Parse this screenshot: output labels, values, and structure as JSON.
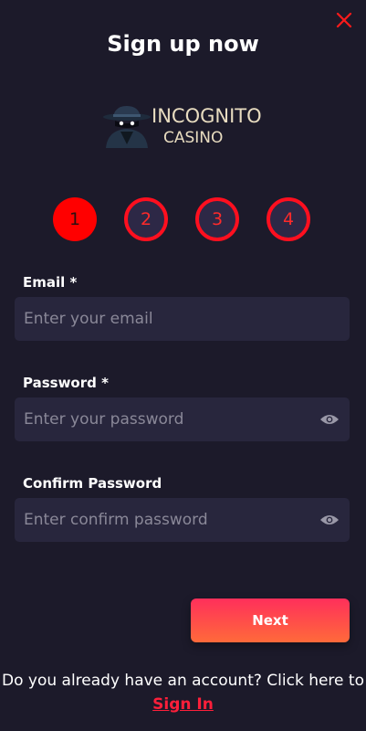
{
  "modal": {
    "title": "Sign up now",
    "close_icon": "close-icon"
  },
  "logo": {
    "line1": "INCOGNITO",
    "line2": "CASINO"
  },
  "steps": [
    {
      "label": "1",
      "state": "active"
    },
    {
      "label": "2",
      "state": "inactive"
    },
    {
      "label": "3",
      "state": "inactive"
    },
    {
      "label": "4",
      "state": "inactive"
    }
  ],
  "form": {
    "email": {
      "label": "Email *",
      "placeholder": "Enter your email",
      "value": ""
    },
    "password": {
      "label": "Password *",
      "placeholder": "Enter your password",
      "value": ""
    },
    "confirm_password": {
      "label": "Confirm Password",
      "placeholder": "Enter confirm password",
      "value": ""
    }
  },
  "next_label": "Next",
  "footer": {
    "text": "Do you already have an account? Click here to",
    "link_label": "Sign In"
  },
  "colors": {
    "background": "#1c1a2a",
    "field_bg": "#28263d",
    "accent_red": "#ff0000",
    "button_gradient_top": "#ff2f5b",
    "button_gradient_bottom": "#ff6a3a"
  }
}
